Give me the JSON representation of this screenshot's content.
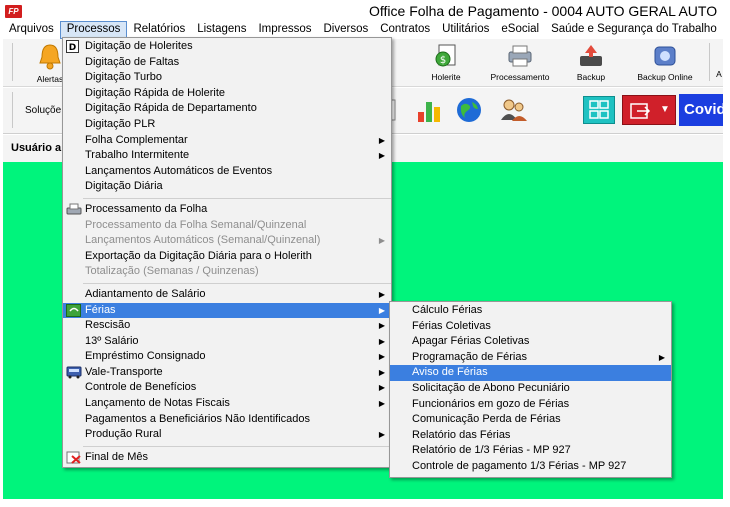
{
  "window": {
    "badge": "FP",
    "title": "Office Folha de Pagamento - 0004 AUTO GERAL AUTO"
  },
  "menubar": [
    "Arquivos",
    "Processos",
    "Relatórios",
    "Listagens",
    "Impressos",
    "Diversos",
    "Contratos",
    "Utilitários",
    "eSocial",
    "Saúde e Segurança do Trabalho"
  ],
  "toolbar": {
    "alertas": "Alertas",
    "holerite": "Holerite",
    "processamento": "Processamento",
    "backup": "Backup",
    "backup_online": "Backup Online",
    "solucoes": "Soluçõe",
    "covid": "Covid"
  },
  "user_label": "Usuário a",
  "processos_menu": [
    {
      "label": "Digitação de Holerites",
      "icon": "d-icon"
    },
    {
      "label": "Digitação de Faltas"
    },
    {
      "label": "Digitação Turbo"
    },
    {
      "label": "Digitação Rápida de Holerite"
    },
    {
      "label": "Digitação Rápida de Departamento"
    },
    {
      "label": "Digitação PLR"
    },
    {
      "label": "Folha Complementar",
      "submenu": true
    },
    {
      "label": "Trabalho Intermitente",
      "submenu": true
    },
    {
      "label": "Lançamentos Automáticos de Eventos"
    },
    {
      "label": "Digitação Diária"
    },
    {
      "divider": true
    },
    {
      "label": "Processamento da Folha",
      "icon": "processing-icon"
    },
    {
      "label": "Processamento da Folha Semanal/Quinzenal",
      "disabled": true
    },
    {
      "label": "Lançamentos Automáticos (Semanal/Quinzenal)",
      "disabled": true,
      "submenu": true
    },
    {
      "label": "Exportação da Digitação Diária para o Holerith"
    },
    {
      "label": "Totalização (Semanas / Quinzenas)",
      "disabled": true
    },
    {
      "divider": true
    },
    {
      "label": "Adiantamento de Salário",
      "submenu": true
    },
    {
      "label": "Férias",
      "submenu": true,
      "highlight": true,
      "icon": "ferias-icon"
    },
    {
      "label": "Rescisão",
      "submenu": true
    },
    {
      "label": "13º Salário",
      "submenu": true
    },
    {
      "label": "Empréstimo Consignado",
      "submenu": true
    },
    {
      "label": "Vale-Transporte",
      "submenu": true,
      "icon": "bus-icon"
    },
    {
      "label": "Controle de Benefícios",
      "submenu": true
    },
    {
      "label": "Lançamento de Notas Fiscais",
      "submenu": true
    },
    {
      "label": "Pagamentos a Beneficiários Não Identificados"
    },
    {
      "label": "Produção Rural",
      "submenu": true
    },
    {
      "divider": true
    },
    {
      "label": "Final de Mês",
      "icon": "final-mes-icon"
    }
  ],
  "ferias_menu": [
    {
      "label": "Cálculo Férias"
    },
    {
      "label": "Férias Coletivas"
    },
    {
      "label": "Apagar Férias Coletivas"
    },
    {
      "label": "Programação de Férias",
      "submenu": true
    },
    {
      "label": "Aviso de Férias",
      "highlight": true
    },
    {
      "label": "Solicitação de Abono Pecuniário"
    },
    {
      "label": "Funcionários em gozo de Férias"
    },
    {
      "label": "Comunicação Perda de Férias"
    },
    {
      "label": "Relatório das Férias"
    },
    {
      "label": "Relatório de 1/3 Férias - MP 927"
    },
    {
      "label": "Controle de pagamento 1/3 Férias - MP 927"
    }
  ],
  "colors": {
    "background_area": "#00f47c",
    "highlight": "#3b7fe0",
    "covid_button": "#1b3ee0"
  }
}
